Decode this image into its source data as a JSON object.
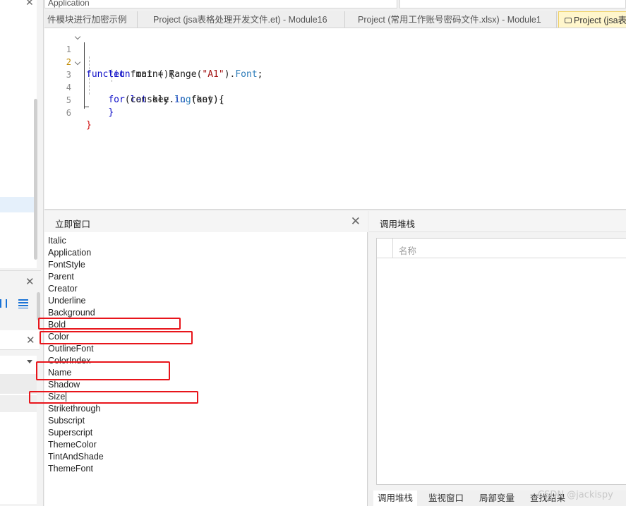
{
  "top_bar": {
    "object_combo": "Application"
  },
  "tabs": [
    {
      "label": "件模块进行加密示例",
      "active": false
    },
    {
      "label": "Project (jsa表格处理开发文件.et) - Module16",
      "active": false
    },
    {
      "label": "Project (常用工作账号密码文件.xlsx) - Module1",
      "active": false
    },
    {
      "label": "Project (jsa表",
      "active": true
    }
  ],
  "editor": {
    "line_numbers": [
      "1",
      "2",
      "3",
      "4",
      "5",
      "6"
    ],
    "current_line": "2",
    "lines": [
      [
        {
          "t": "function",
          "c": "kw"
        },
        {
          "t": " main(){",
          "c": "fn"
        }
      ],
      [
        {
          "t": "    ",
          "c": "var"
        },
        {
          "t": "let",
          "c": "kw"
        },
        {
          "t": " font = Range(",
          "c": "var"
        },
        {
          "t": "\"A1\"",
          "c": "str"
        },
        {
          "t": ").",
          "c": "var"
        },
        {
          "t": "Font",
          "c": "prop"
        },
        {
          "t": ";",
          "c": "var"
        }
      ],
      [
        {
          "t": "    ",
          "c": "var"
        },
        {
          "t": "for",
          "c": "kw"
        },
        {
          "t": "(",
          "c": "var"
        },
        {
          "t": "let",
          "c": "kw"
        },
        {
          "t": " key ",
          "c": "var"
        },
        {
          "t": "in",
          "c": "kw"
        },
        {
          "t": " font){",
          "c": "var"
        }
      ],
      [
        {
          "t": "        console.",
          "c": "var"
        },
        {
          "t": "log",
          "c": "prop"
        },
        {
          "t": "(key);",
          "c": "var"
        }
      ],
      [
        {
          "t": "    ",
          "c": "var"
        },
        {
          "t": "}",
          "c": "kw"
        }
      ],
      [
        {
          "t": "}",
          "c": "brace-red"
        }
      ]
    ]
  },
  "immediate_window": {
    "title": "立即窗口",
    "items": [
      "Italic",
      "Application",
      "FontStyle",
      "Parent",
      "Creator",
      "Underline",
      "Background",
      "Bold",
      "Color",
      "OutlineFont",
      "ColorIndex",
      "Name",
      "Shadow",
      "Size",
      "Strikethrough",
      "Subscript",
      "Superscript",
      "ThemeColor",
      "TintAndShade",
      "ThemeFont"
    ],
    "highlighted": [
      "Bold",
      "Color",
      "Name",
      "Size"
    ],
    "highlight_color": "#e8151b"
  },
  "call_stack": {
    "title": "调用堆栈",
    "column_name": "名称",
    "bottom_tabs": [
      {
        "label": "调用堆栈",
        "active": true
      },
      {
        "label": "监视窗口",
        "active": false
      },
      {
        "label": "局部变量",
        "active": false
      },
      {
        "label": "查找结果",
        "active": false
      }
    ]
  },
  "watermark": "CSDN @jackispy"
}
